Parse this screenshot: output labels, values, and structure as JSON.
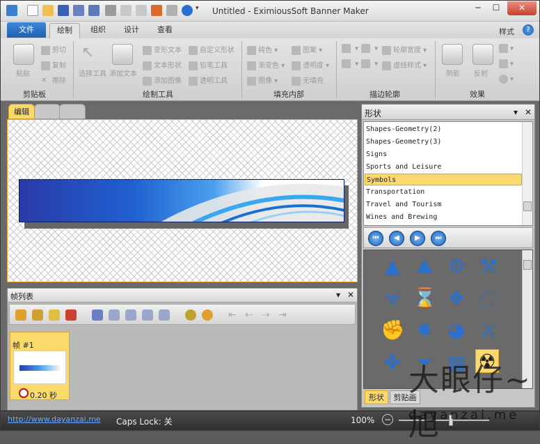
{
  "window": {
    "title": "Untitled - EximiousSoft Banner Maker"
  },
  "ribbon": {
    "file_tab": "文件",
    "tabs": [
      "绘制",
      "组织",
      "设计",
      "查看"
    ],
    "style_menu": "样式",
    "help": "?",
    "groups": {
      "clipboard": {
        "label": "剪贴板",
        "paste": "粘贴",
        "cut": "剪切",
        "copy": "复制",
        "delete": "擦除"
      },
      "draw": {
        "label": "绘制工具",
        "select": "选择工具",
        "add_text": "添加文本",
        "warp_text": "变形文本",
        "text_shape": "文本形状",
        "add_image": "添加图像",
        "custom_shape": "自定义形状",
        "pencil": "铅笔工具",
        "transparent": "透明工具"
      },
      "fill": {
        "label": "填充内部",
        "solid": "纯色",
        "gradient": "渐变色",
        "image": "图像",
        "pattern": "图案",
        "opacity": "透明度",
        "no_fill": "无填充"
      },
      "stroke": {
        "label": "描边轮廓",
        "width": "轮廓宽度",
        "dash": "虚线样式"
      },
      "effects": {
        "label": "效果",
        "shadow": "阴影",
        "reflection": "反射"
      }
    }
  },
  "document": {
    "tabs": [
      "编辑",
      "",
      ""
    ]
  },
  "frame_panel": {
    "title": "帧列表",
    "frame_name": "帧 #1",
    "frame_time": "0.20 秒"
  },
  "shape_panel": {
    "title": "形状",
    "categories": [
      "Shapes-Geometry(2)",
      "Shapes-Geometry(3)",
      "Signs",
      "Sports and Leisure",
      "Symbols",
      "Transportation",
      "Travel and Tourism",
      "Wines and Brewing"
    ],
    "selected": "Symbols",
    "tabs": [
      "形状",
      "剪贴画"
    ]
  },
  "status": {
    "url": "http://www.dayanzai.me",
    "caps_lock": "Caps Lock: 关",
    "zoom": "100%"
  },
  "watermark": {
    "main": "大眼仔~旭",
    "sub": "dayanzai.me"
  },
  "colors": {
    "accent": "#1c5fb0",
    "selection": "#fcd96e",
    "shape_icon": "#2a70cc"
  }
}
